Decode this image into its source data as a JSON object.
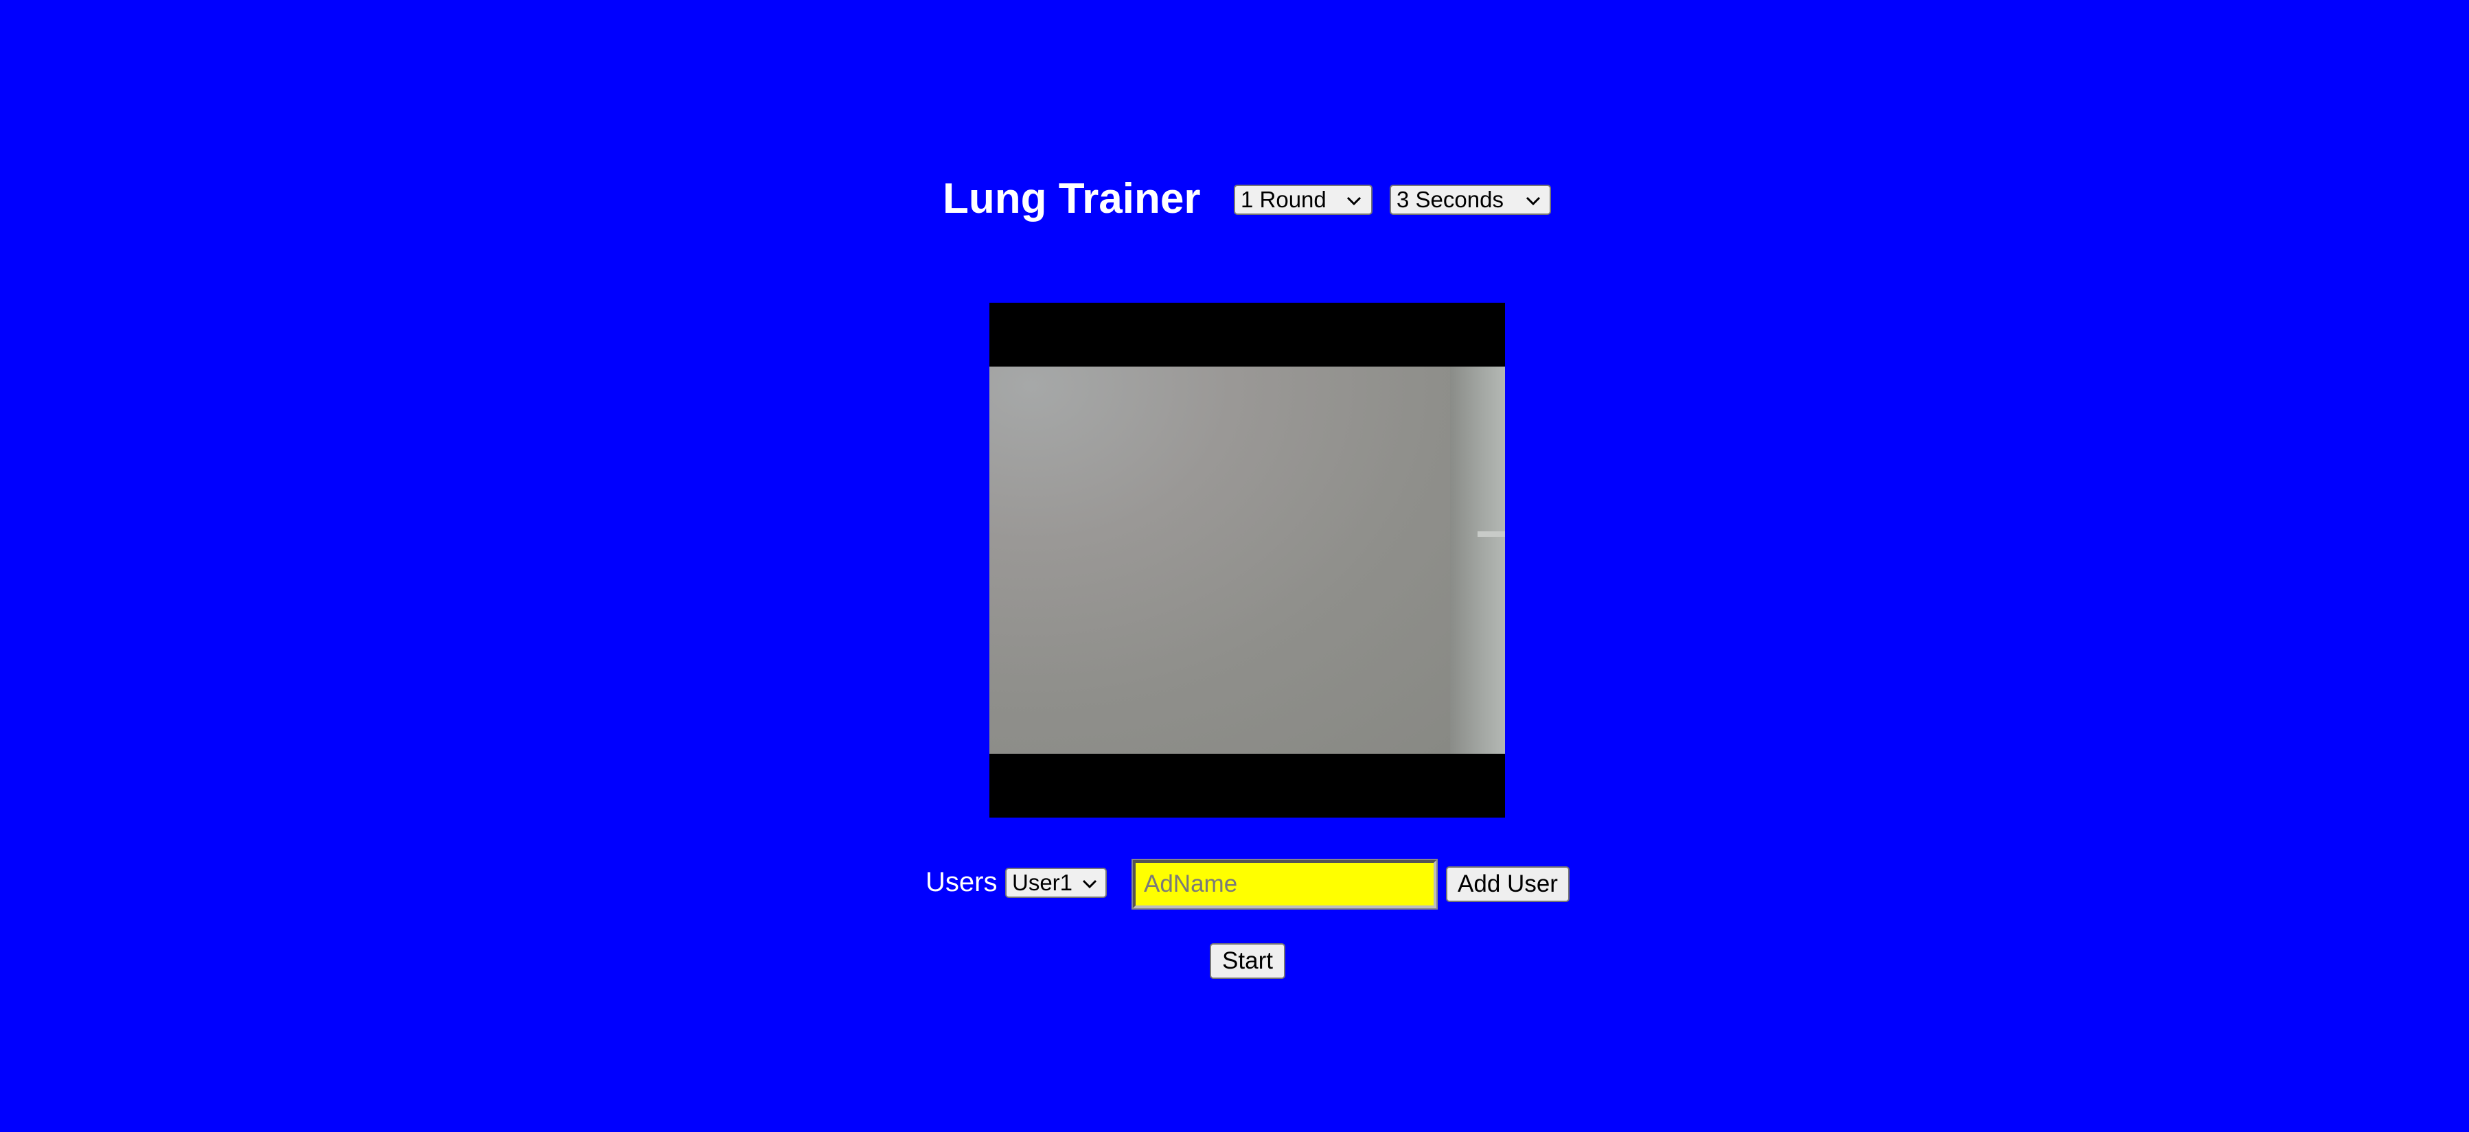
{
  "app": {
    "title": "Lung Trainer"
  },
  "header": {
    "rounds_select": {
      "selected": "1 Round",
      "icon": "chevron-down-icon"
    },
    "seconds_select": {
      "selected": "3 Seconds",
      "icon": "chevron-down-icon"
    }
  },
  "camera": {
    "label": "camera-feed"
  },
  "users": {
    "label": "Users",
    "select": {
      "selected": "User1",
      "icon": "chevron-down-icon"
    },
    "name_input": {
      "value": "",
      "placeholder": "AdName"
    },
    "add_button_label": "Add User"
  },
  "actions": {
    "start_label": "Start"
  },
  "colors": {
    "background": "#0000ff",
    "title_text": "#ffffff",
    "input_highlight": "#ffff00",
    "camera_border": "#000000"
  }
}
